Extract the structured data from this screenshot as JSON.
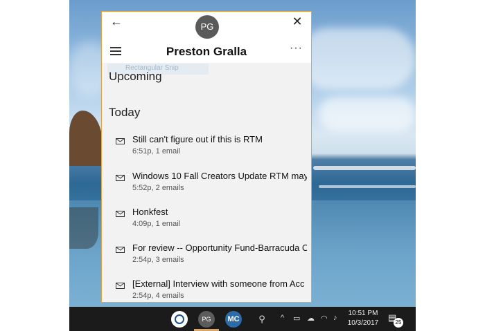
{
  "window": {
    "avatar_initials": "PG",
    "account_name": "Preston Gralla",
    "back_glyph": "←",
    "close_glyph": "✕",
    "more_glyph": "···",
    "ghost_text": "Rectangular Snip"
  },
  "sections": {
    "upcoming": "Upcoming",
    "today": "Today"
  },
  "emails": [
    {
      "subject": "Still can't figure out if this is RTM",
      "meta": "6:51p, 1 email"
    },
    {
      "subject": "Windows 10 Fall Creators Update RTM may",
      "meta": "5:52p, 2 emails"
    },
    {
      "subject": "Honkfest",
      "meta": "4:09p, 1 email"
    },
    {
      "subject": "For review -- Opportunity Fund-Barracuda C",
      "meta": "2:54p, 3 emails"
    },
    {
      "subject": "[External] Interview with someone from Acc",
      "meta": "2:54p, 4 emails"
    }
  ],
  "taskbar": {
    "pg_label": "PG",
    "mc_label": "MC",
    "time": "10:51 PM",
    "date": "10/3/2017",
    "notification_count": "25",
    "icons": [
      "cortana-icon",
      "people-icon",
      "chevron-up-icon",
      "battery-icon",
      "onedrive-icon",
      "wifi-icon",
      "volume-icon",
      "action-center-icon"
    ]
  },
  "colors": {
    "window_border": "#e7a244",
    "taskbar": "#1b1b1b",
    "avatar": "#5a5a5a"
  }
}
